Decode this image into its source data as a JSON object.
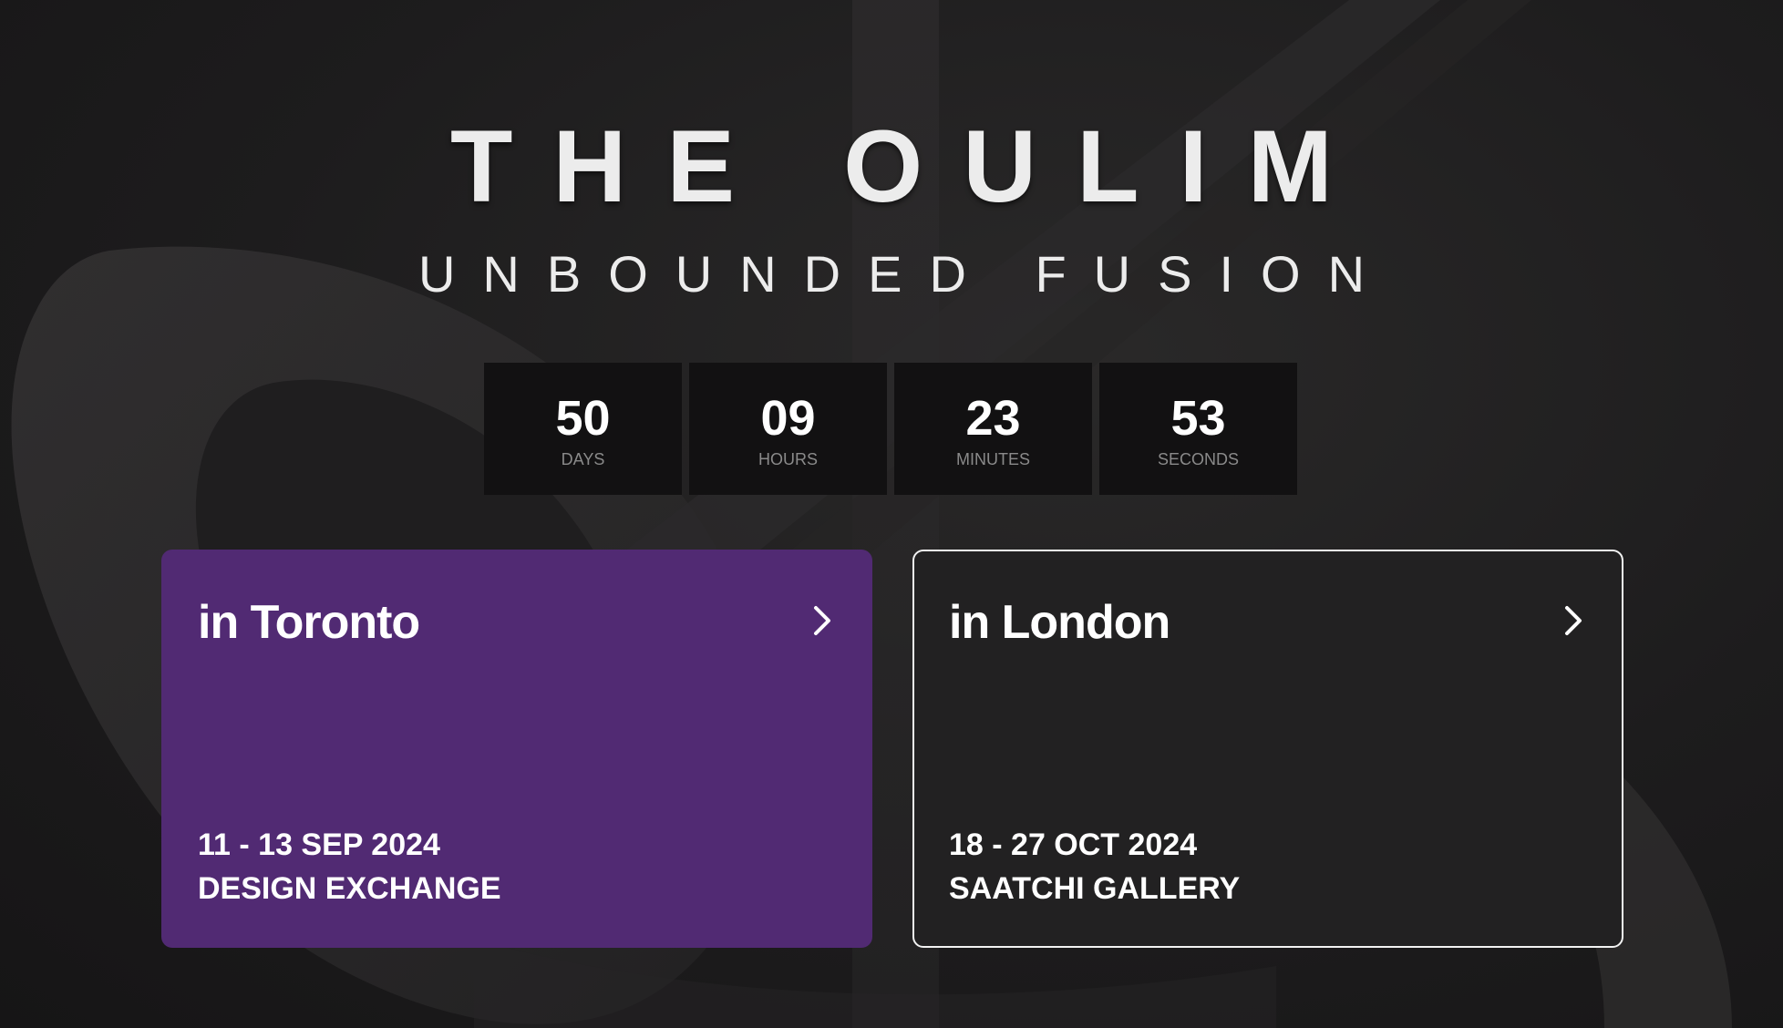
{
  "hero": {
    "title": "THE OULIM",
    "subtitle": "UNBOUNDED FUSION"
  },
  "countdown": [
    {
      "value": "50",
      "label": "DAYS"
    },
    {
      "value": "09",
      "label": "HOURS"
    },
    {
      "value": "23",
      "label": "MINUTES"
    },
    {
      "value": "53",
      "label": "SECONDS"
    }
  ],
  "events": [
    {
      "city": "in Toronto",
      "dates": "11 - 13 SEP 2024",
      "venue": "DESIGN EXCHANGE",
      "accent": "#512a73",
      "arrow_icon": "chevron-right-icon"
    },
    {
      "city": "in London",
      "dates": "18 - 27 OCT 2024",
      "venue": "SAATCHI GALLERY",
      "accent": "#222122",
      "arrow_icon": "chevron-right-icon"
    }
  ],
  "colors": {
    "background": "#1c1b1c",
    "countdown_cell": "#121112",
    "toronto_card": "#512a73",
    "london_card_border": "#f2f2f2"
  }
}
